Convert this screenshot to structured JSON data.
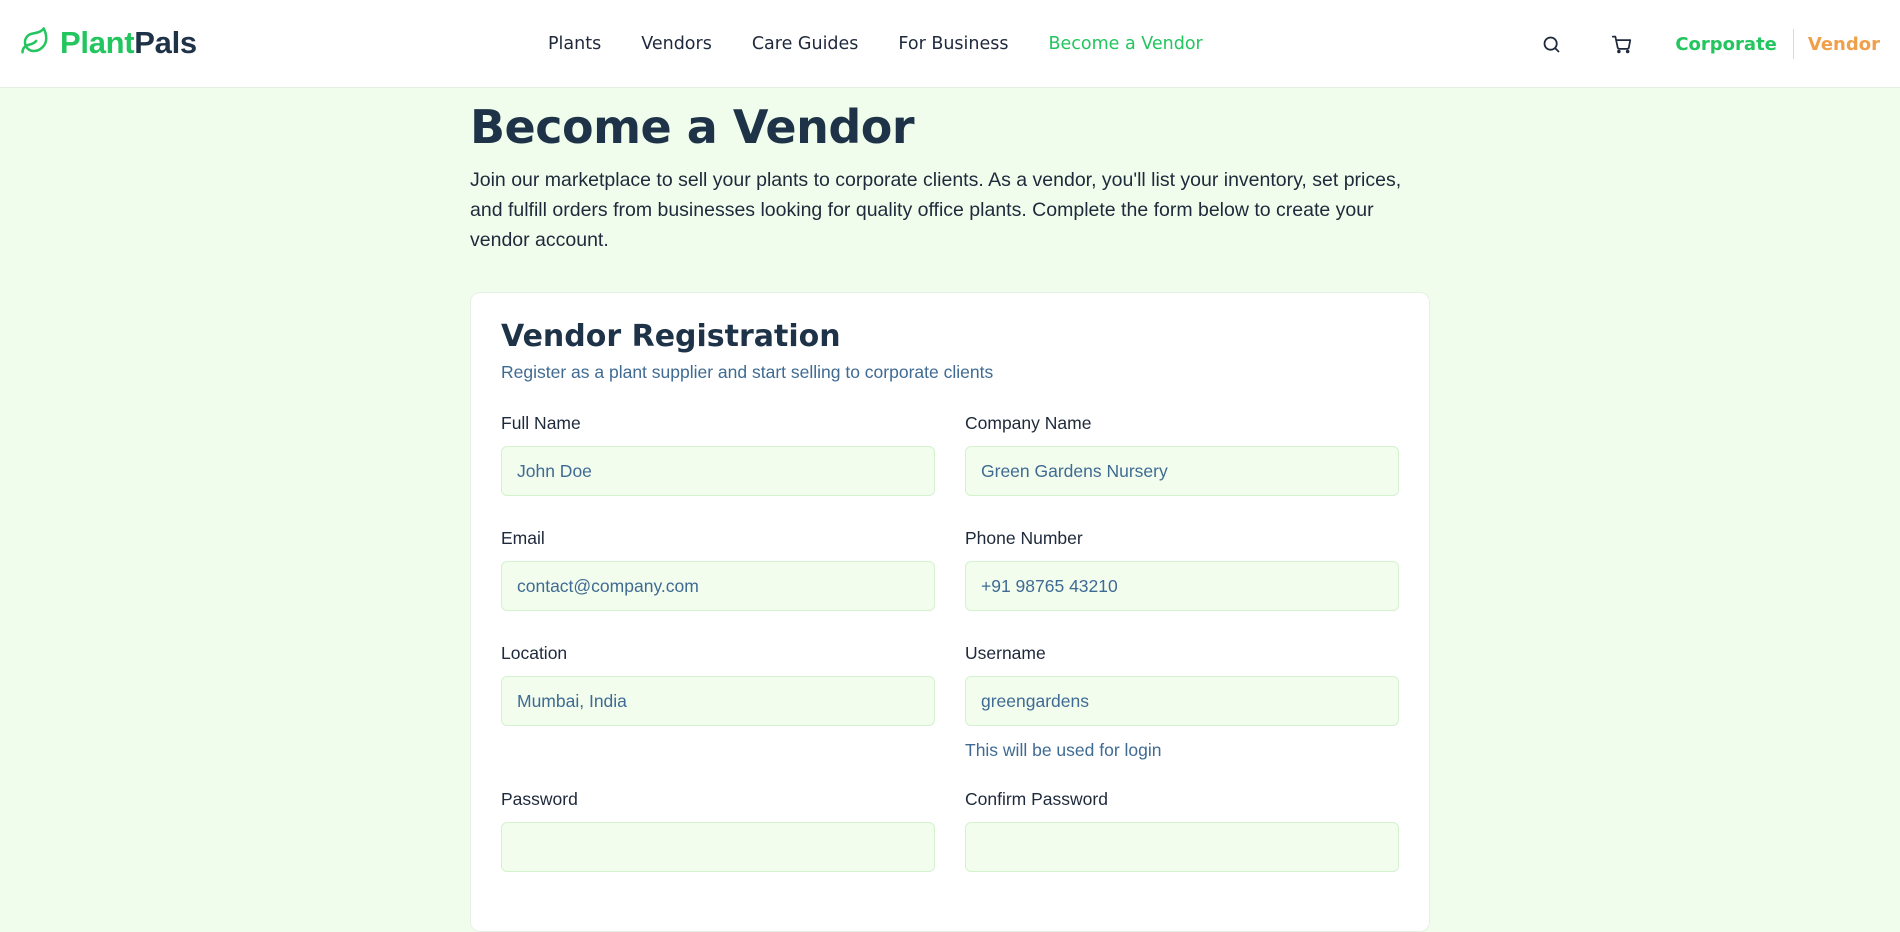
{
  "brand": {
    "part1": "Plant",
    "part2": "Pals",
    "accent": "#22c55e",
    "dark": "#1e3347"
  },
  "nav": {
    "items": [
      {
        "label": "Plants",
        "active": false
      },
      {
        "label": "Vendors",
        "active": false
      },
      {
        "label": "Care Guides",
        "active": false
      },
      {
        "label": "For Business",
        "active": false
      },
      {
        "label": "Become a Vendor",
        "active": true
      }
    ]
  },
  "header": {
    "search_icon": "search-icon",
    "cart_icon": "cart-icon",
    "role_corporate": "Corporate",
    "role_vendor": "Vendor",
    "vendor_color": "#f0a04b"
  },
  "page": {
    "title": "Become a Vendor",
    "intro": "Join our marketplace to sell your plants to corporate clients. As a vendor, you'll list your inventory, set prices, and fulfill orders from businesses looking for quality office plants. Complete the form below to create your vendor account."
  },
  "form": {
    "title": "Vendor Registration",
    "subtitle": "Register as a plant supplier and start selling to corporate clients",
    "fields": {
      "full_name": {
        "label": "Full Name",
        "placeholder": "John Doe"
      },
      "company_name": {
        "label": "Company Name",
        "placeholder": "Green Gardens Nursery"
      },
      "email": {
        "label": "Email",
        "placeholder": "contact@company.com"
      },
      "phone": {
        "label": "Phone Number",
        "placeholder": "+91 98765 43210"
      },
      "location": {
        "label": "Location",
        "placeholder": "Mumbai, India"
      },
      "username": {
        "label": "Username",
        "placeholder": "greengardens",
        "hint": "This will be used for login"
      },
      "password": {
        "label": "Password",
        "placeholder": ""
      },
      "confirm_password": {
        "label": "Confirm Password",
        "placeholder": ""
      }
    }
  }
}
